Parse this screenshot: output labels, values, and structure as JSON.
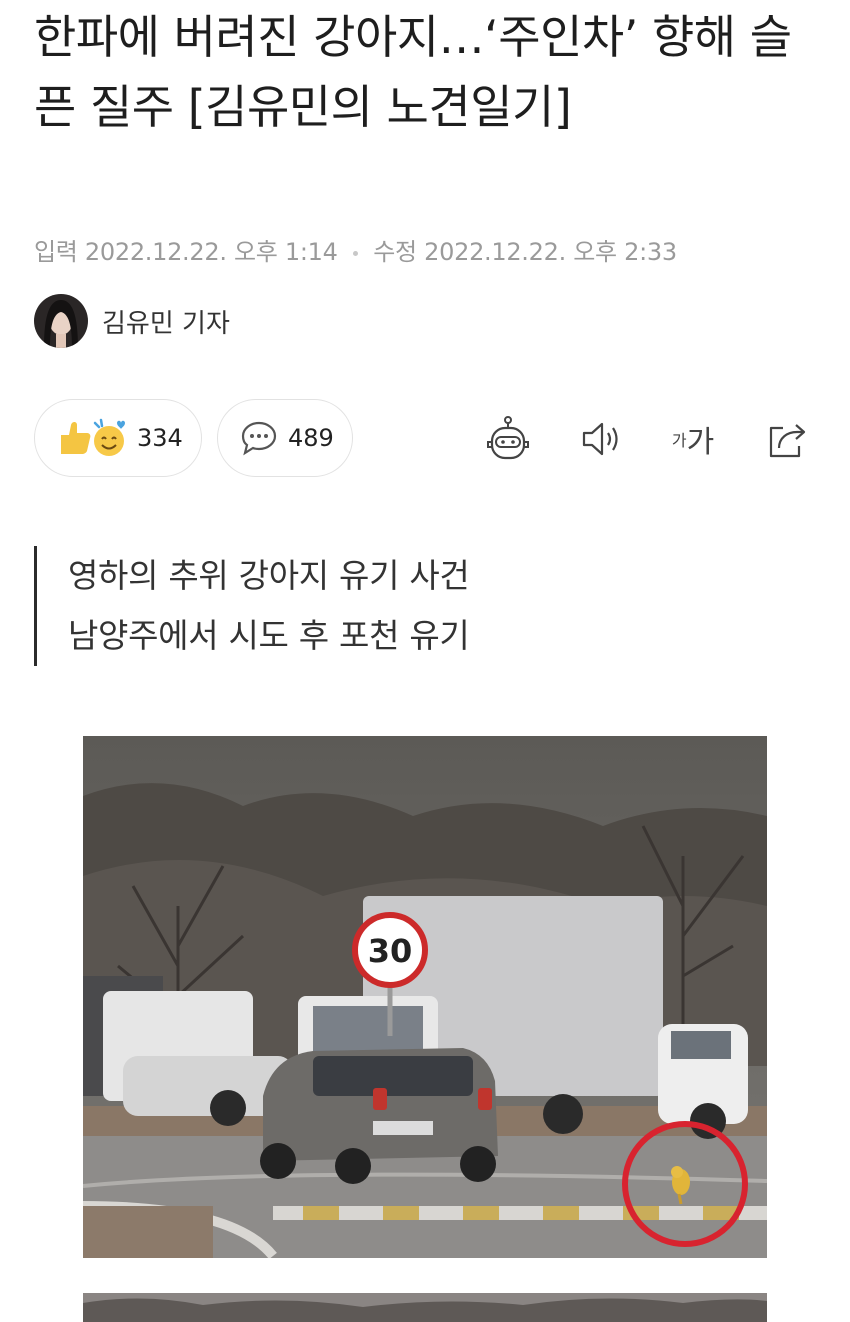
{
  "article": {
    "headline": "한파에 버려진 강아지…‘주인차’ 향해 슬픈 질주 [김유민의 노견일기]",
    "input_label": "입력",
    "input_time": "2022.12.22. 오후 1:14",
    "edit_label": "수정",
    "edit_time": "2022.12.22. 오후 2:33",
    "author": "김유민 기자",
    "summary": [
      "영하의 추위 강아지 유기 사건",
      "남양주에서 시도 후 포천 유기"
    ]
  },
  "actions": {
    "reactions_count": "334",
    "comments_count": "489",
    "tools": [
      "robot-summary-icon",
      "speaker-icon",
      "font-size-icon",
      "share-icon"
    ],
    "font_small": "가",
    "font_big": "가"
  },
  "photo": {
    "speed_sign": "30"
  },
  "colors": {
    "circle_highlight": "#d8232f",
    "meta_text": "#9a9a9a"
  }
}
